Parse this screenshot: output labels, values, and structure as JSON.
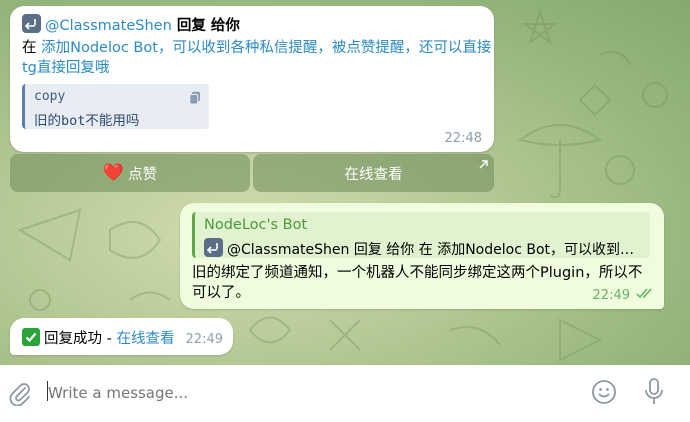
{
  "colors": {
    "accent": "#2b8ac6",
    "outgoing_bubble": "#effdde",
    "outgoing_name": "#4c9a3a"
  },
  "msg1": {
    "reply_icon": "reply-icon",
    "user": "@ClassmateShen",
    "action": " 回复 给你",
    "in_prefix": "在 ",
    "topic": "添加Nodeloc Bot，可以收到各种私信提醒，被点赞提醒，还可以直接tg直接回复哦",
    "code_lang": "copy",
    "copy_icon": "copy-icon",
    "code_text_1": "旧的",
    "code_text_2": "bot",
    "code_text_3": "不能用吗",
    "time": "22:48"
  },
  "buttons": {
    "like_emoji": "❤️",
    "like_label": "点赞",
    "view_label": "在线查看"
  },
  "msg2": {
    "quote_name": "NodeLoc's Bot",
    "quote_text": "@ClassmateShen 回复 给你 在 添加Nodeloc Bot，可以收到各种私信提醒，被点赞提醒",
    "body": "旧的绑定了频道通知，一个机器人不能同步绑定这两个Plugin，所以不可以了。",
    "time": "22:49",
    "status_icon": "double-check-icon"
  },
  "msg3": {
    "prefix": "回复成功 - ",
    "link": "在线查看",
    "time": "22:49"
  },
  "composer": {
    "placeholder": "Write a message..."
  }
}
